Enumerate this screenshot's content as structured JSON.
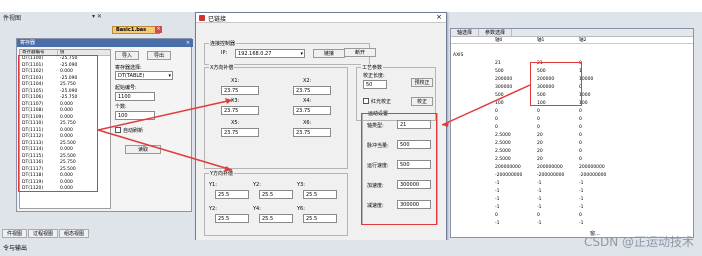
{
  "ide": {
    "project_view_label": "件视图",
    "bottom_tabs": [
      "件视图",
      "过程视图",
      "组态视图"
    ],
    "status_label": "令与输出",
    "right_bottom_tab": "窗..."
  },
  "file_tab": {
    "label": "Basic1.bas",
    "close": "×"
  },
  "register_panel": {
    "title": "寄存器",
    "close": "×",
    "columns": [
      "寄存器编号",
      "值"
    ],
    "rows": [
      [
        "DT(1100)",
        "-25.750"
      ],
      [
        "DT(1101)",
        "-25.090"
      ],
      [
        "DT(1102)",
        "0.000"
      ],
      [
        "DT(1103)",
        "-25.090"
      ],
      [
        "DT(1104)",
        "25.750"
      ],
      [
        "DT(1105)",
        "-25.090"
      ],
      [
        "DT(1106)",
        "-25.750"
      ],
      [
        "DT(1107)",
        "0.000"
      ],
      [
        "DT(1108)",
        "0.000"
      ],
      [
        "DT(1109)",
        "0.000"
      ],
      [
        "DT(1110)",
        "25.750"
      ],
      [
        "DT(1111)",
        "0.000"
      ],
      [
        "DT(1112)",
        "0.000"
      ],
      [
        "DT(1113)",
        "25.500"
      ],
      [
        "DT(1114)",
        "0.000"
      ],
      [
        "DT(1115)",
        "25.500"
      ],
      [
        "DT(1116)",
        "25.750"
      ],
      [
        "DT(1117)",
        "25.500"
      ],
      [
        "DT(1118)",
        "0.000"
      ],
      [
        "DT(1119)",
        "0.000"
      ],
      [
        "DT(1120)",
        "0.000"
      ]
    ],
    "import_button": "导入",
    "export_button": "导出",
    "register_select_label": "寄存器选择:",
    "register_select_value": "DT(TABLE)",
    "start_no_label": "起始编号:",
    "start_no_value": "1100",
    "count_label": "个数:",
    "count_value": "100",
    "auto_refresh_label": "自动刷新",
    "read_button": "读取"
  },
  "dialog": {
    "title": "已链接",
    "close": "×",
    "controller_group": "连接控制器",
    "ip_label": "IP:",
    "ip_value": "192.168.0.27",
    "connect_button": "链接",
    "disconnect_button": "断开",
    "x_group": "X方向补偿",
    "x_fields": [
      {
        "label": "X1:",
        "value": "23.75"
      },
      {
        "label": "X2:",
        "value": "23.75"
      },
      {
        "label": "X3:",
        "value": "23.75"
      },
      {
        "label": "X4:",
        "value": "23.75"
      },
      {
        "label": "X5:",
        "value": "23.75"
      },
      {
        "label": "X6:",
        "value": "23.75"
      }
    ],
    "y_group": "Y方向补偿",
    "y_fields": [
      {
        "label": "Y1:",
        "value": "25.5"
      },
      {
        "label": "Y2:",
        "value": "25.5"
      },
      {
        "label": "Y3:",
        "value": "25.5"
      },
      {
        "label": "Y2:",
        "value": "25.5"
      },
      {
        "label": "Y4:",
        "value": "25.5"
      },
      {
        "label": "Y6:",
        "value": "25.5"
      }
    ],
    "process_group": "工艺参数",
    "calib_len_label": "校正长度:",
    "calib_len_value": "50",
    "pre_calib_button": "预校正",
    "red_light_label": "红光校正",
    "calibrate_button": "校正",
    "motion_group": "运动设置",
    "motion_fields": [
      {
        "label": "轴类型:",
        "value": "21"
      },
      {
        "label": "脉冲当量:",
        "value": "500"
      },
      {
        "label": "运行速度:",
        "value": "500"
      },
      {
        "label": "加速度:",
        "value": "300000"
      },
      {
        "label": "减速度:",
        "value": "300000"
      }
    ]
  },
  "right_panel": {
    "tabs": [
      "轴选择",
      "参数选择"
    ],
    "columns": [
      "",
      "轴0",
      "轴1",
      "轴2"
    ],
    "rows": [
      [
        "",
        "",
        "",
        ""
      ],
      [
        "AXIS",
        "",
        "",
        ""
      ],
      [
        "",
        "21",
        "21",
        "0"
      ],
      [
        "",
        "500",
        "500",
        "1"
      ],
      [
        "",
        "200000",
        "200000",
        "10000"
      ],
      [
        "",
        "300000",
        "300000",
        "0"
      ],
      [
        "",
        "500",
        "500",
        "1000"
      ],
      [
        "",
        "100",
        "100",
        "100"
      ],
      [
        "",
        "0",
        "0",
        "0"
      ],
      [
        "",
        "0",
        "0",
        "0"
      ],
      [
        "",
        "0",
        "0",
        "0"
      ],
      [
        "",
        "2.5000",
        "20",
        "0"
      ],
      [
        "",
        "2.5000",
        "20",
        "0"
      ],
      [
        "",
        "2.5000",
        "20",
        "0"
      ],
      [
        "",
        "2.5000",
        "20",
        "0"
      ],
      [
        "",
        "200000000",
        "200000000",
        "200000000"
      ],
      [
        "",
        "-200000000",
        "-200000000",
        "-200000000"
      ],
      [
        "",
        "-1",
        "-1",
        "-1"
      ],
      [
        "",
        "-1",
        "-1",
        "-1"
      ],
      [
        "",
        "-1",
        "-1",
        "-1"
      ],
      [
        "",
        "-1",
        "-1",
        "-1"
      ],
      [
        "",
        "0",
        "0",
        "0"
      ],
      [
        "",
        "-1",
        "-1",
        "-1"
      ]
    ]
  },
  "watermark": "CSDN @正运动技术"
}
